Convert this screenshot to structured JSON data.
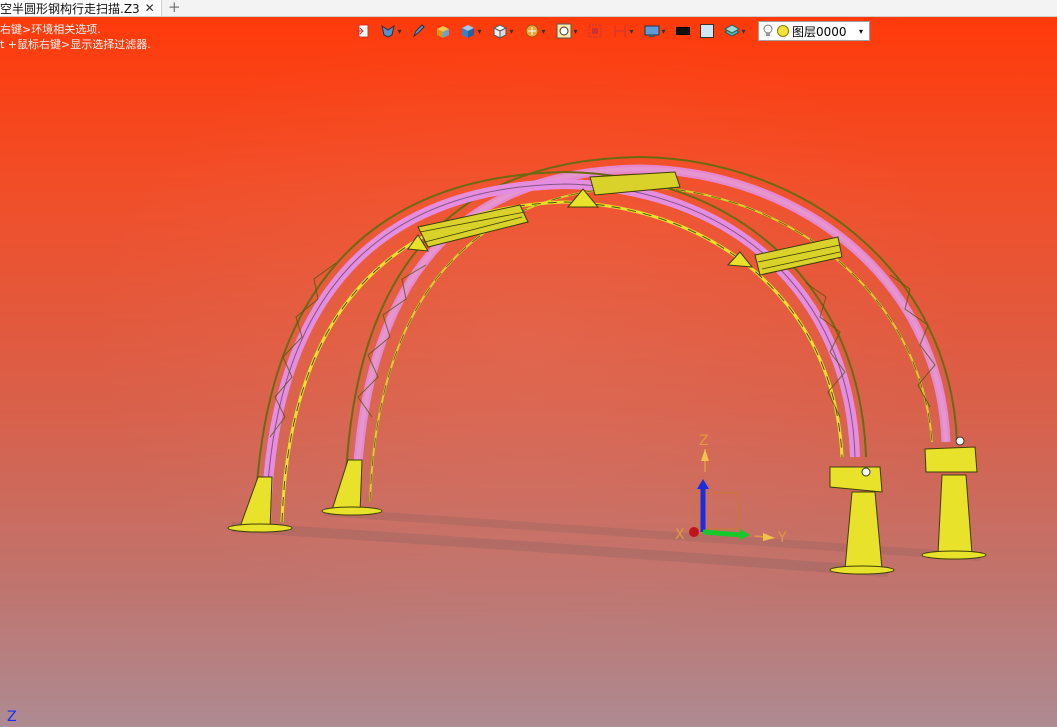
{
  "tab": {
    "title": "空半圆形钢构行走扫描.Z3",
    "close_glyph": "✕",
    "add_glyph": "+"
  },
  "hints": {
    "line1": "右键>环境相关选项.",
    "line2": "t +鼠标右键>显示选择过滤器."
  },
  "toolbar": {
    "buttons": [
      {
        "name": "exit-sketch-icon"
      },
      {
        "name": "view-filter-icon"
      },
      {
        "name": "pick-pencil-icon"
      },
      {
        "name": "shaded-box-icon"
      },
      {
        "name": "blue-cube-icon"
      },
      {
        "name": "white-cube-icon"
      },
      {
        "name": "render-style-icon"
      },
      {
        "name": "zoom-window-icon"
      },
      {
        "name": "fit-icon"
      },
      {
        "name": "section-icon"
      },
      {
        "name": "display-settings-icon"
      },
      {
        "name": "line-color-icon"
      },
      {
        "name": "face-color-icon"
      },
      {
        "name": "layer-manager-icon"
      }
    ],
    "layer": {
      "name": "图层0000"
    }
  },
  "axes": {
    "x": "X",
    "y": "Y",
    "z": "Z",
    "corner": "Z"
  },
  "colors": {
    "truss_yellow": "#e8e22a",
    "tube_pink": "#e58ee0",
    "bg_top": "#ff3a0a",
    "bg_bottom": "#ad8b92"
  }
}
